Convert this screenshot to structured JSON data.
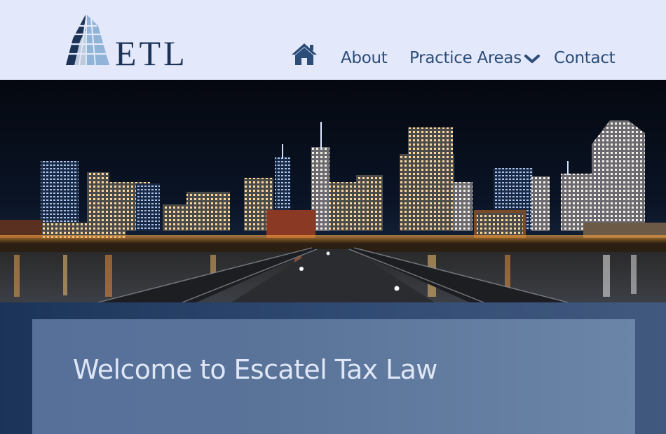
{
  "brand": {
    "logo_text": "ETL",
    "colors": {
      "navy": "#1c3357",
      "light_blue": "#8fb4d8",
      "header_bg": "#e4e8fb",
      "nav_text": "#2b4d78"
    }
  },
  "nav": {
    "home_icon": "home-icon",
    "items": [
      {
        "label": "About"
      },
      {
        "label": "Practice Areas",
        "icon": "chevron-down-icon"
      },
      {
        "label": "Contact"
      }
    ]
  },
  "hero": {
    "image": "night city skyline with pier"
  },
  "welcome": {
    "title": "Welcome to Escatel Tax Law"
  }
}
